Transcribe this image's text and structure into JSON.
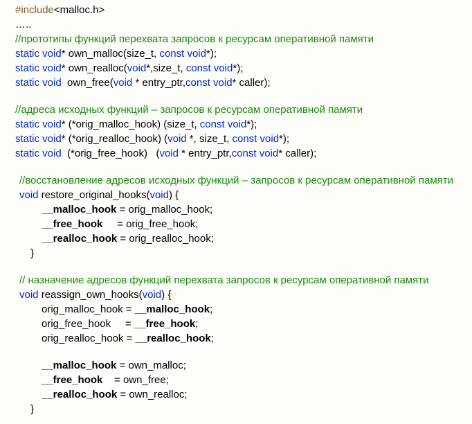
{
  "l01_include": "#include",
  "l01_rest": "<malloc.h>",
  "l02": "…..",
  "l03": "//прототипы функций перехвата запросов к ресурсам оперативной памяти",
  "l04_a": "static void",
  "l04_b": "* own_malloc(size_t, ",
  "l04_c": "const void",
  "l04_d": "*);",
  "l05_a": "static void",
  "l05_b": "* own_realloc(",
  "l05_c": "void",
  "l05_d": "*,size_t, ",
  "l05_e": "const void",
  "l05_f": "*);",
  "l06_a": "static void",
  "l06_b": "  own_free(",
  "l06_c": "void",
  "l06_d": " * entry_ptr,",
  "l06_e": "const void",
  "l06_f": "* caller);",
  "l07": "//адреса исходных функций – запросов к ресурсам оперативной памяти",
  "l08_a": "static void",
  "l08_b": "* (*orig_malloc_hook) (size_t, ",
  "l08_c": "const void",
  "l08_d": "*);",
  "l09_a": "static void",
  "l09_b": "* (*orig_realloc_hook) (",
  "l09_c": "void",
  "l09_d": " *, size_t, ",
  "l09_e": "const void",
  "l09_f": "*);",
  "l10_a": "static void",
  "l10_b": "  (*orig_free_hook)   (",
  "l10_c": "void",
  "l10_d": " * entry_ptr,",
  "l10_e": "const void",
  "l10_f": "* caller);",
  "l11": "//восстановление адресов исходных функций – запросов к ресурсам оперативной памяти",
  "l12_a": "void",
  "l12_b": " restore_original_hooks(",
  "l12_c": "void",
  "l12_d": ") {",
  "l13_a": "__malloc_hook",
  "l13_b": " = orig_malloc_hook;",
  "l14_a": "__free_hook",
  "l14_b": "     = orig_free_hook;",
  "l15_a": "__realloc_hook",
  "l15_b": " = orig_realloc_hook;",
  "l16": "}",
  "l17": "// назначение адресов функций перехвата запросов к ресурсам оперативной памяти",
  "l18_a": "void",
  "l18_b": " reassign_own_hooks(",
  "l18_c": "void",
  "l18_d": ") {",
  "l19_a": "orig_malloc_hook = ",
  "l19_b": "__malloc_hook",
  "l19_c": ";",
  "l20_a": "orig_free_hook     = ",
  "l20_b": "__free_hook",
  "l20_c": ";",
  "l21_a": "orig_realloc_hook = ",
  "l21_b": "__realloc_hook",
  "l21_c": ";",
  "l22_a": "__malloc_hook",
  "l22_b": " = own_malloc;",
  "l23_a": "__free_hook",
  "l23_b": "    = own_free;",
  "l24_a": "__realloc_hook",
  "l24_b": " = own_realloc;",
  "l25": "}"
}
